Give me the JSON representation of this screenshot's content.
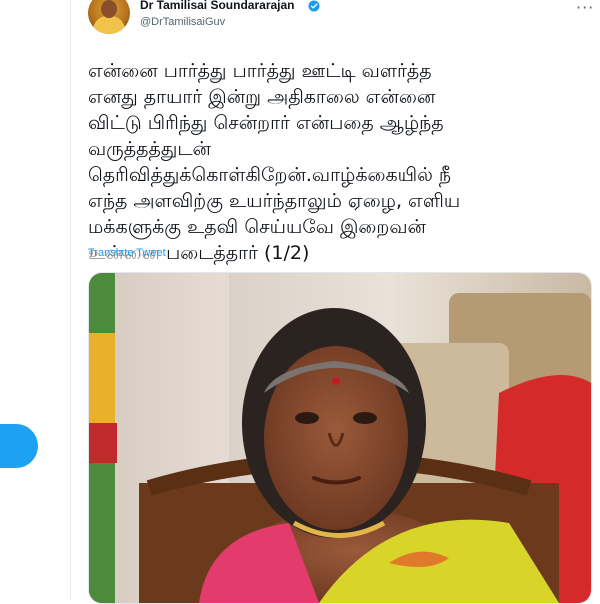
{
  "author": {
    "name": "Dr Tamilisai Soundararajan",
    "handle": "@DrTamilisaiGuv",
    "avatar_icon": "profile-avatar",
    "verified_icon": "verified-badge-icon"
  },
  "tweet": {
    "lines": [
      "என்னை பார்த்து பார்த்து ஊட்டி வளர்த்த",
      "எனது தாயார் இன்று அதிகாலை என்னை",
      "விட்டு பிரிந்து சென்றார் என்பதை ஆழ்ந்த",
      "வருத்தத்துடன்",
      "தெரிவித்துக்கொள்கிறேன்.வாழ்க்கையில் நீ",
      "எந்த அளவிற்கு உயர்ந்தாலும் ஏழை, எளிய",
      "மக்களுக்கு உதவி செய்யவே இறைவன்",
      "உன்னை படைத்தார் (1/2)"
    ],
    "translate_label": "Translate Tweet",
    "more_label": "···"
  },
  "colors": {
    "accent": "#1d9bf0",
    "button": "#1da1f2",
    "text": "#0f1419",
    "secondary": "#536471"
  }
}
